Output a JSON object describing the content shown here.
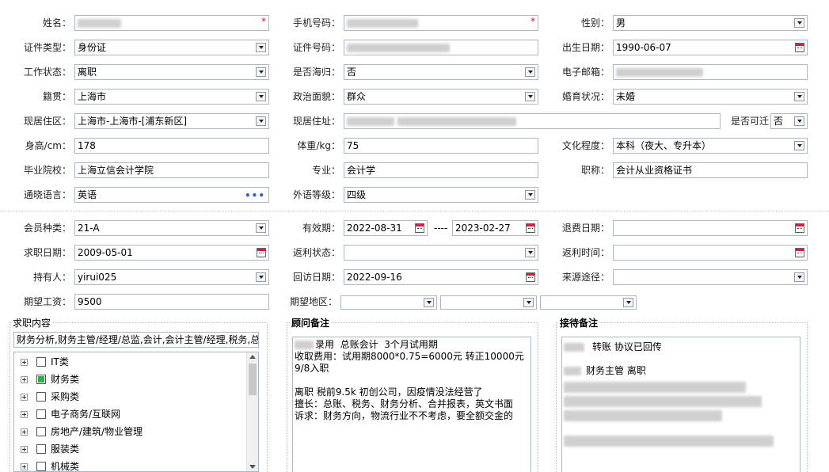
{
  "personal": {
    "name_label": "姓名：",
    "phone_label": "手机号码：",
    "gender_label": "性别：",
    "gender": "男",
    "idtype_label": "证件类型：",
    "idtype": "身份证",
    "idnum_label": "证件号码：",
    "birth_label": "出生日期：",
    "birth": "1990-06-07",
    "workstatus_label": "工作状态：",
    "workstatus": "离职",
    "returnee_label": "是否海归：",
    "returnee": "否",
    "email_label": "电子邮箱：",
    "native_label": "籍贯：",
    "native": "上海市",
    "political_label": "政治面貌：",
    "political": "群众",
    "marital_label": "婚育状况：",
    "marital": "未婚",
    "residence_area_label": "现居住区：",
    "residence_area": "上海市-上海市-[浦东新区]",
    "residence_addr_label": "现居住址：",
    "relocate_label": "是否可迁",
    "relocate": "否",
    "height_label": "身高/cm：",
    "height": "178",
    "weight_label": "体重/kg：",
    "weight": "75",
    "education_label": "文化程度：",
    "education": "本科（夜大、专升本）",
    "school_label": "毕业院校：",
    "school": "上海立信会计学院",
    "major_label": "专业：",
    "major": "会计学",
    "title_label": "职称：",
    "title": "会计从业资格证书",
    "language_label": "通晓语言：",
    "language": "英语",
    "foreign_level_label": "外语等级：",
    "foreign_level": "四级"
  },
  "membership": {
    "member_type_label": "会员种类：",
    "member_type": "21-A",
    "validity_label": "有效期：",
    "valid_from": "2022-08-31",
    "valid_sep": "----",
    "valid_to": "2023-02-27",
    "refund_date_label": "退费日期：",
    "job_date_label": "求职日期：",
    "job_date": "2009-05-01",
    "rebate_status_label": "返利状态：",
    "rebate_time_label": "返利时间：",
    "holder_label": "持有人：",
    "holder": "yirui025",
    "visit_date_label": "回访日期：",
    "visit_date": "2022-09-16",
    "source_label": "来源途径：",
    "salary_label": "期望工资：",
    "salary": "9500",
    "region_label": "期望地区："
  },
  "job_content": {
    "title": "求职内容",
    "summary": "财务分析,财务主管/经理/总监,会计,会计主管/经理,税务,总",
    "items": [
      {
        "label": "IT类",
        "checked": false
      },
      {
        "label": "财务类",
        "checked": true
      },
      {
        "label": "采购类",
        "checked": false
      },
      {
        "label": "电子商务/互联网",
        "checked": false
      },
      {
        "label": "房地产/建筑/物业管理",
        "checked": false
      },
      {
        "label": "服装类",
        "checked": false
      },
      {
        "label": "机械类",
        "checked": false
      }
    ]
  },
  "consultant_note": {
    "title": "顾问备注",
    "line1": "录用  总账会计  3个月试用期",
    "line2": "收取费用：试用期8000*0.75=6000元 转正10000元",
    "line3": "9/8入职",
    "line4": "离职 税前9.5k 初创公司，因疫情没法经营了",
    "line5": "擅长：总账、税务、财务分析、合并报表，英文书面",
    "line6": "诉求：财务方向，物流行业不不考虑，要全额交金的"
  },
  "reception_note": {
    "title": "接待备注",
    "line1": "转账 协议已回传",
    "line2": "财务主管 离职"
  },
  "colors": {
    "border": "#a9b7c8",
    "required": "#e03",
    "checked": "#2bb14a"
  }
}
